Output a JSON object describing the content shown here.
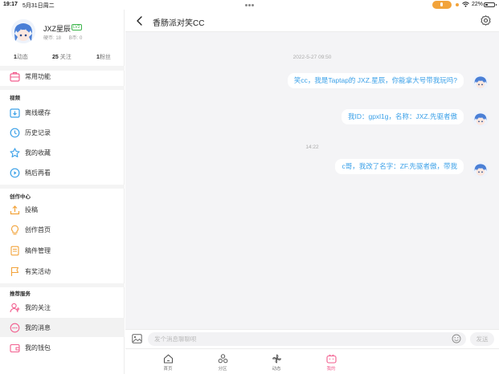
{
  "status": {
    "time": "19:17",
    "date": "5月31日周二",
    "battery": "22%"
  },
  "profile": {
    "username": "JXZ星辰",
    "level": "LV2",
    "hard_coins": "硬币: 18",
    "b_coins": "B币: 0",
    "dynamics": "1",
    "dynamics_label": "动态",
    "following": "25",
    "following_label": "关注",
    "fans": "1",
    "fans_label": "粉丝"
  },
  "menu": {
    "common": "常用功能",
    "section_video": "视频",
    "offline": "离线缓存",
    "history": "历史记录",
    "favorites": "我的收藏",
    "watch_later": "稍后再看",
    "section_creator": "创作中心",
    "submit": "投稿",
    "creator_home": "创作首页",
    "drafts": "稿件管理",
    "rewards": "有奖活动",
    "section_recommend": "推荐服务",
    "my_follows": "我的关注",
    "my_messages": "我的消息",
    "my_wallet": "我的钱包"
  },
  "chat": {
    "title": "香肠派对笑CC",
    "timestamp1": "2022-5-27 09:50",
    "msg1": "笑cc，我是Taptap的 JXZ.星辰，你能拿大号带我玩吗?",
    "msg2": "我ID：gpxl1g，名称：JXZ.先驱者傲",
    "timestamp2": "14:22",
    "msg3": "c哥，我改了名字：ZF.先驱者傲，带我",
    "input_placeholder": "发个消息聊聊呗",
    "send": "发送"
  },
  "tabs": {
    "home": "首页",
    "category": "分区",
    "dynamic": "动态",
    "mine": "我的"
  },
  "colors": {
    "accent_pink": "#f25d8e",
    "bubble_text": "#3aa0e8"
  }
}
